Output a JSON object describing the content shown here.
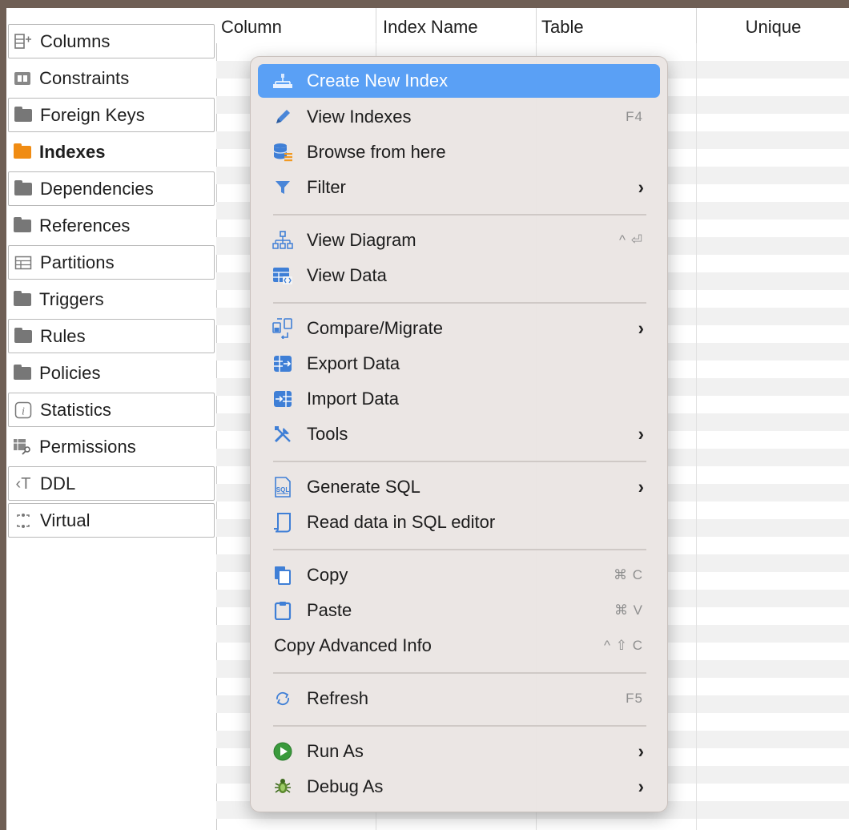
{
  "tabs": [
    {
      "label": "Columns",
      "icon": "columns-add-icon"
    },
    {
      "label": "Constraints",
      "icon": "constraints-icon"
    },
    {
      "label": "Foreign Keys",
      "icon": "folder-icon"
    },
    {
      "label": "Indexes",
      "icon": "folder-orange-icon",
      "active": true
    },
    {
      "label": "Dependencies",
      "icon": "folder-icon"
    },
    {
      "label": "References",
      "icon": "folder-icon"
    },
    {
      "label": "Partitions",
      "icon": "partitions-icon"
    },
    {
      "label": "Triggers",
      "icon": "folder-icon"
    },
    {
      "label": "Rules",
      "icon": "folder-icon"
    },
    {
      "label": "Policies",
      "icon": "folder-icon"
    },
    {
      "label": "Statistics",
      "icon": "info-icon"
    },
    {
      "label": "Permissions",
      "icon": "permissions-icon"
    },
    {
      "label": "DDL",
      "icon": "ddl-icon"
    },
    {
      "label": "Virtual",
      "icon": "virtual-icon"
    }
  ],
  "table": {
    "columns": [
      "Column",
      "Index Name",
      "Table",
      "Unique"
    ]
  },
  "menu": {
    "items": [
      {
        "label": "Create New Index",
        "icon": "create-index-icon",
        "highlighted": true
      },
      {
        "label": "View Indexes",
        "icon": "pencil-icon",
        "shortcut": "F4"
      },
      {
        "label": "Browse from here",
        "icon": "database-browse-icon"
      },
      {
        "label": "Filter",
        "icon": "filter-icon",
        "submenu": true
      },
      {
        "label": "View Diagram",
        "icon": "diagram-icon",
        "shortcut": "^ ⏎"
      },
      {
        "label": "View Data",
        "icon": "view-data-icon"
      },
      {
        "label": "Compare/Migrate",
        "icon": "compare-icon",
        "submenu": true
      },
      {
        "label": "Export Data",
        "icon": "export-icon"
      },
      {
        "label": "Import Data",
        "icon": "import-icon"
      },
      {
        "label": "Tools",
        "icon": "tools-icon",
        "submenu": true
      },
      {
        "label": "Generate SQL",
        "icon": "sql-icon",
        "submenu": true
      },
      {
        "label": "Read data in SQL editor",
        "icon": "sql-editor-icon"
      },
      {
        "label": "Copy",
        "icon": "copy-icon",
        "shortcut": "⌘ C"
      },
      {
        "label": "Paste",
        "icon": "paste-icon",
        "shortcut": "⌘ V"
      },
      {
        "label": "Copy Advanced Info",
        "shortcut": "^ ⇧ C"
      },
      {
        "label": "Refresh",
        "icon": "refresh-icon",
        "shortcut": "F5"
      },
      {
        "label": "Run As",
        "icon": "run-icon",
        "submenu": true
      },
      {
        "label": "Debug As",
        "icon": "debug-icon",
        "submenu": true
      }
    ],
    "submenu_glyph": "›"
  },
  "colors": {
    "highlight": "#5aa0f5",
    "active_folder": "#f08c13",
    "frame": "#6f5f55"
  }
}
